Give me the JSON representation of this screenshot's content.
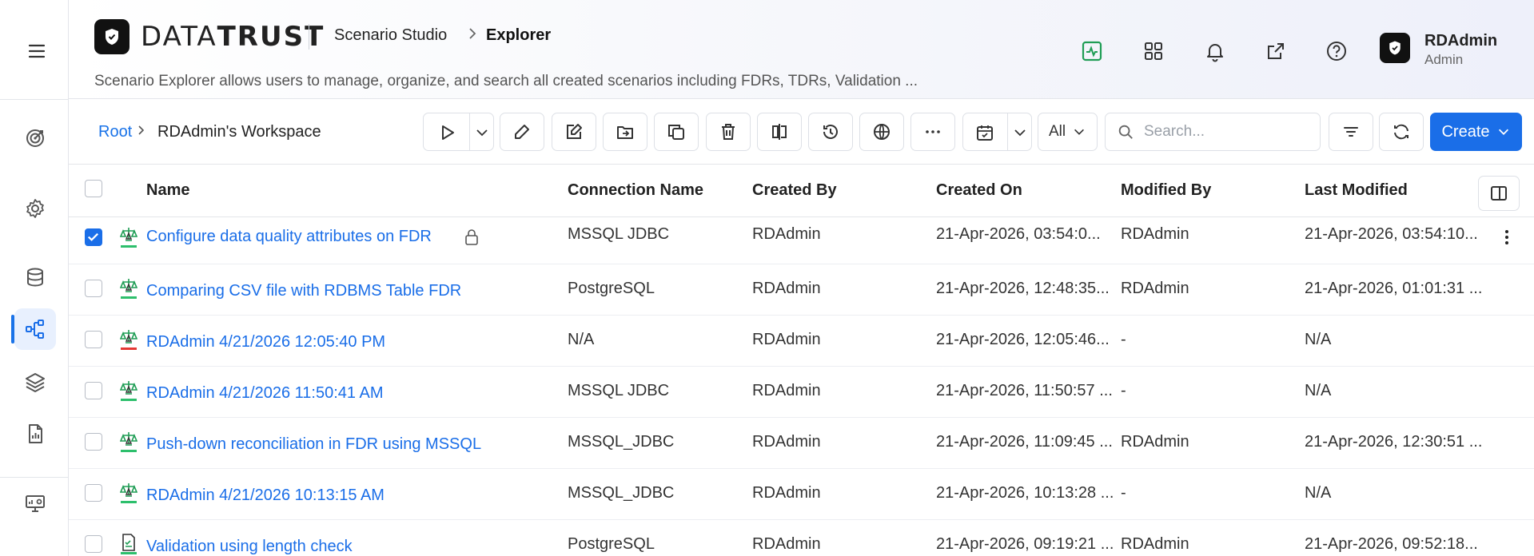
{
  "brand": {
    "name_light": "DATA",
    "name_bold": "TRUST"
  },
  "header": {
    "app": "Scenario Studio",
    "page": "Explorer",
    "description": "Scenario Explorer allows users to manage, organize, and search all created scenarios including FDRs, TDRs, Validation ..."
  },
  "user": {
    "name": "RDAdmin",
    "role": "Admin"
  },
  "breadcrumb": {
    "root": "Root",
    "workspace": "RDAdmin's Workspace"
  },
  "toolbar": {
    "filter_scope": "All",
    "search_placeholder": "Search...",
    "create_label": "Create"
  },
  "table": {
    "columns": [
      "Name",
      "Connection Name",
      "Created By",
      "Created On",
      "Modified By",
      "Last Modified"
    ],
    "rows": [
      {
        "name": "Configure data quality attributes on FDR",
        "connection": "MSSQL JDBC",
        "created_by": "RDAdmin",
        "created_on": "21-Apr-2026, 03:54:0...",
        "modified_by": "RDAdmin",
        "last_modified": "21-Apr-2026, 03:54:10...",
        "checked": true,
        "locked": true,
        "status": "green",
        "icon": "fdr-icon"
      },
      {
        "name": "Comparing CSV file with RDBMS Table FDR",
        "connection": "PostgreSQL",
        "created_by": "RDAdmin",
        "created_on": "21-Apr-2026, 12:48:35...",
        "modified_by": "RDAdmin",
        "last_modified": "21-Apr-2026, 01:01:31 ...",
        "checked": false,
        "locked": false,
        "status": "green",
        "icon": "fdr-icon"
      },
      {
        "name": "RDAdmin 4/21/2026 12:05:40 PM",
        "connection": "N/A",
        "created_by": "RDAdmin",
        "created_on": "21-Apr-2026, 12:05:46...",
        "modified_by": "-",
        "last_modified": "N/A",
        "checked": false,
        "locked": false,
        "status": "red",
        "icon": "fdr-icon"
      },
      {
        "name": "RDAdmin 4/21/2026 11:50:41 AM",
        "connection": "MSSQL JDBC",
        "created_by": "RDAdmin",
        "created_on": "21-Apr-2026, 11:50:57 ...",
        "modified_by": "-",
        "last_modified": "N/A",
        "checked": false,
        "locked": false,
        "status": "green",
        "icon": "fdr-icon"
      },
      {
        "name": "Push-down reconciliation in FDR using MSSQL",
        "connection": "MSSQL_JDBC",
        "created_by": "RDAdmin",
        "created_on": "21-Apr-2026, 11:09:45 ...",
        "modified_by": "RDAdmin",
        "last_modified": "21-Apr-2026, 12:30:51 ...",
        "checked": false,
        "locked": false,
        "status": "green",
        "icon": "fdr-icon"
      },
      {
        "name": "RDAdmin 4/21/2026 10:13:15 AM",
        "connection": "MSSQL_JDBC",
        "created_by": "RDAdmin",
        "created_on": "21-Apr-2026, 10:13:28 ...",
        "modified_by": "-",
        "last_modified": "N/A",
        "checked": false,
        "locked": false,
        "status": "green",
        "icon": "fdr-icon"
      },
      {
        "name": "Validation using length check",
        "connection": "PostgreSQL",
        "created_by": "RDAdmin",
        "created_on": "21-Apr-2026, 09:19:21 ...",
        "modified_by": "RDAdmin",
        "last_modified": "21-Apr-2026, 09:52:18...",
        "checked": false,
        "locked": false,
        "status": "green",
        "icon": "validation-icon"
      }
    ]
  },
  "colors": {
    "accent": "#1a6ee8",
    "status_green": "#2dbf6c",
    "status_red": "#e53935",
    "icon_green": "#1f9d55"
  }
}
